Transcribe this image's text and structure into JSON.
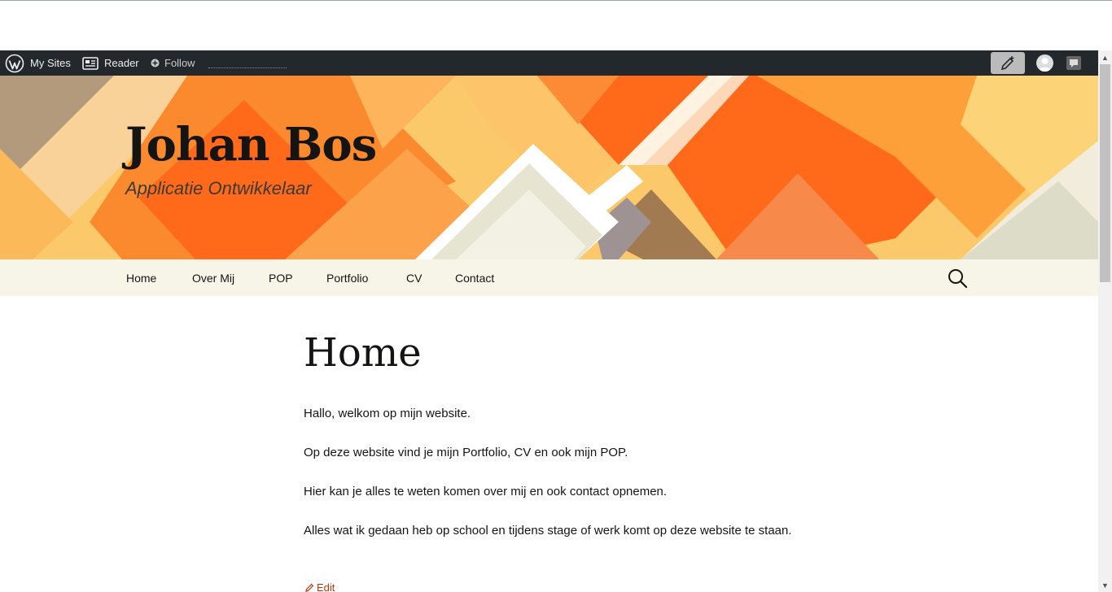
{
  "admin_bar": {
    "my_sites_label": "My Sites",
    "reader_label": "Reader",
    "follow_label": "Follow"
  },
  "site": {
    "title": "Johan Bos",
    "description": "Applicatie Ontwikkelaar"
  },
  "nav": {
    "items": [
      {
        "label": "Home"
      },
      {
        "label": "Over Mij"
      },
      {
        "label": "POP"
      },
      {
        "label": "Portfolio"
      },
      {
        "label": "CV"
      },
      {
        "label": "Contact"
      }
    ]
  },
  "page": {
    "title": "Home",
    "paragraphs": [
      "Hallo, welkom op mijn website.",
      "Op deze website vind je mijn Portfolio, CV en ook mijn POP.",
      "Hier kan je alles te weten komen over mij en ook contact opnemen.",
      "Alles wat ik gedaan heb op school en tijdens stage of werk komt op deze website te staan."
    ],
    "edit_label": "Edit"
  },
  "colors": {
    "admin_bar_bg": "#23282d",
    "nav_bg": "#f7f5e7",
    "link_accent": "#bc360a"
  }
}
